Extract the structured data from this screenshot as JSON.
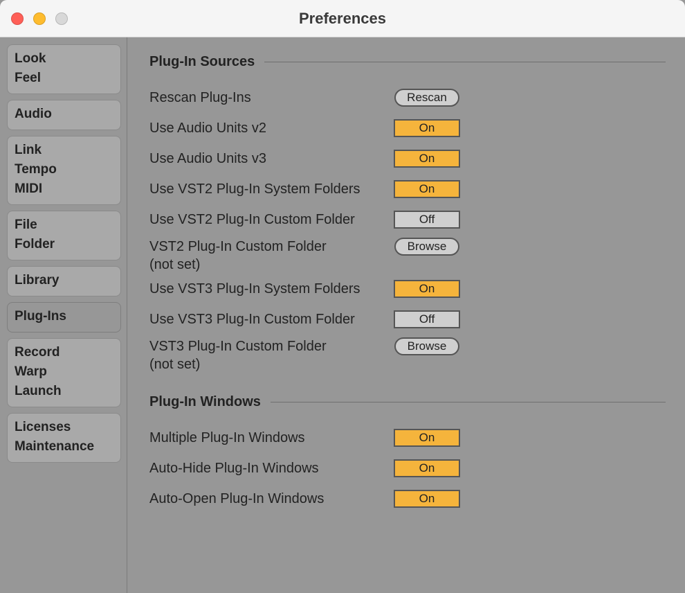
{
  "window": {
    "title": "Preferences"
  },
  "sidebar": {
    "groups": [
      {
        "id": "look-feel",
        "lines": [
          "Look",
          "Feel"
        ],
        "active": false
      },
      {
        "id": "audio",
        "lines": [
          "Audio"
        ],
        "active": false
      },
      {
        "id": "link-tempo-midi",
        "lines": [
          "Link",
          "Tempo",
          "MIDI"
        ],
        "active": false
      },
      {
        "id": "file-folder",
        "lines": [
          "File",
          "Folder"
        ],
        "active": false
      },
      {
        "id": "library",
        "lines": [
          "Library"
        ],
        "active": false
      },
      {
        "id": "plug-ins",
        "lines": [
          "Plug-Ins"
        ],
        "active": true
      },
      {
        "id": "record-warp-launch",
        "lines": [
          "Record",
          "Warp",
          "Launch"
        ],
        "active": false
      },
      {
        "id": "licenses-maintenance",
        "lines": [
          "Licenses",
          "Maintenance"
        ],
        "active": false
      }
    ]
  },
  "sections": {
    "sources": {
      "title": "Plug-In Sources",
      "rescan": {
        "label": "Rescan Plug-Ins",
        "button": "Rescan"
      },
      "au_v2": {
        "label": "Use Audio Units v2",
        "value": "On"
      },
      "au_v3": {
        "label": "Use Audio Units v3",
        "value": "On"
      },
      "vst2_sys": {
        "label": "Use VST2 Plug-In System Folders",
        "value": "On"
      },
      "vst2_custom": {
        "label": "Use VST2 Plug-In Custom Folder",
        "value": "Off"
      },
      "vst2_browse": {
        "label": "VST2 Plug-In Custom Folder",
        "sub": "(not set)",
        "button": "Browse"
      },
      "vst3_sys": {
        "label": "Use VST3 Plug-In System Folders",
        "value": "On"
      },
      "vst3_custom": {
        "label": "Use VST3 Plug-In Custom Folder",
        "value": "Off"
      },
      "vst3_browse": {
        "label": "VST3 Plug-In Custom Folder",
        "sub": "(not set)",
        "button": "Browse"
      }
    },
    "windows": {
      "title": "Plug-In Windows",
      "multiple": {
        "label": "Multiple Plug-In Windows",
        "value": "On"
      },
      "autohide": {
        "label": "Auto-Hide Plug-In Windows",
        "value": "On"
      },
      "autoopen": {
        "label": "Auto-Open Plug-In Windows",
        "value": "On"
      }
    }
  }
}
